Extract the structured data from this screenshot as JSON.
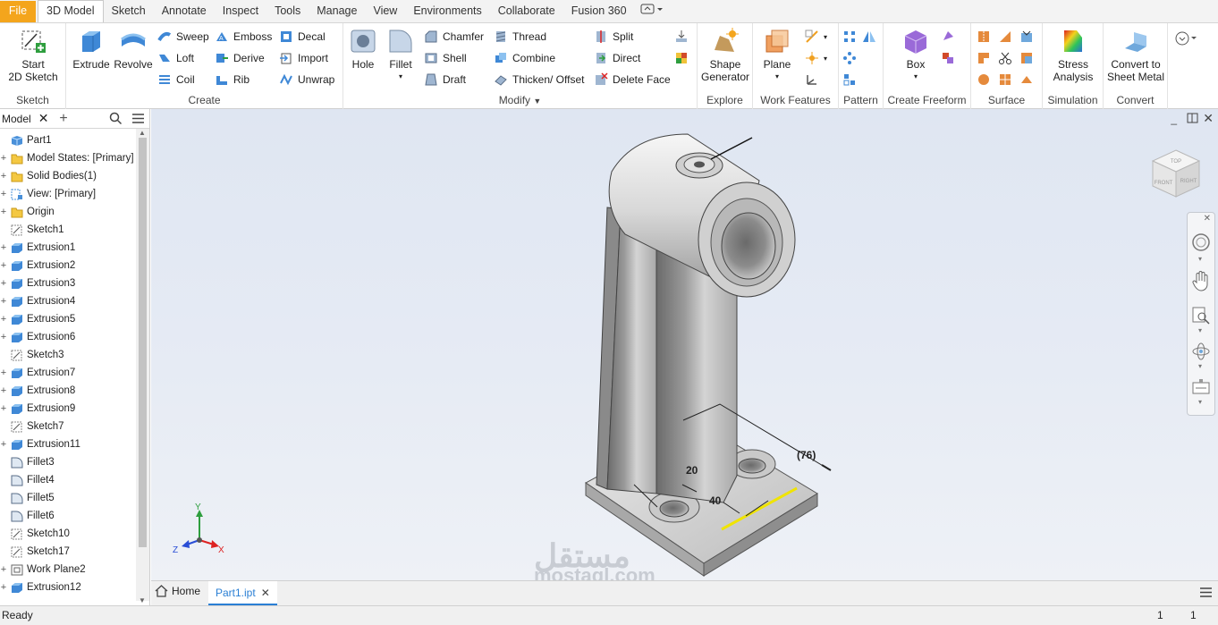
{
  "menu": [
    "File",
    "3D Model",
    "Sketch",
    "Annotate",
    "Inspect",
    "Tools",
    "Manage",
    "View",
    "Environments",
    "Collaborate",
    "Fusion 360"
  ],
  "ribbon": {
    "sketch": {
      "label": "Sketch",
      "start": "Start",
      "start2": "2D Sketch"
    },
    "create": {
      "label": "Create",
      "extrude": "Extrude",
      "revolve": "Revolve",
      "sweep": "Sweep",
      "emboss": "Emboss",
      "decal": "Decal",
      "loft": "Loft",
      "derive": "Derive",
      "import": "Import",
      "coil": "Coil",
      "rib": "Rib",
      "unwrap": "Unwrap"
    },
    "modify": {
      "label": "Modify",
      "hole": "Hole",
      "fillet": "Fillet",
      "chamfer": "Chamfer",
      "thread": "Thread",
      "split": "Split",
      "shell": "Shell",
      "combine": "Combine",
      "direct": "Direct",
      "draft": "Draft",
      "thicken": "Thicken/ Offset",
      "delete_face": "Delete Face"
    },
    "explore": {
      "label": "Explore",
      "shape1": "Shape",
      "shape2": "Generator"
    },
    "work": {
      "label": "Work Features",
      "plane": "Plane"
    },
    "pattern": {
      "label": "Pattern"
    },
    "freeform": {
      "label": "Create Freeform",
      "box": "Box"
    },
    "surface": {
      "label": "Surface"
    },
    "simulation": {
      "label": "Simulation",
      "stress1": "Stress",
      "stress2": "Analysis"
    },
    "convert": {
      "label": "Convert",
      "sm1": "Convert to",
      "sm2": "Sheet Metal"
    }
  },
  "browser": {
    "tab": "Model",
    "items": [
      {
        "label": "Part1",
        "icon": "part",
        "plus": ""
      },
      {
        "label": "Model States: [Primary]",
        "icon": "folder",
        "plus": "+"
      },
      {
        "label": "Solid Bodies(1)",
        "icon": "folder",
        "plus": "+"
      },
      {
        "label": "View: [Primary]",
        "icon": "view",
        "plus": "+"
      },
      {
        "label": "Origin",
        "icon": "folder",
        "plus": "+"
      },
      {
        "label": "Sketch1",
        "icon": "sketch",
        "plus": ""
      },
      {
        "label": "Extrusion1",
        "icon": "extrude",
        "plus": "+"
      },
      {
        "label": "Extrusion2",
        "icon": "extrude",
        "plus": "+"
      },
      {
        "label": "Extrusion3",
        "icon": "extrude",
        "plus": "+"
      },
      {
        "label": "Extrusion4",
        "icon": "extrude",
        "plus": "+"
      },
      {
        "label": "Extrusion5",
        "icon": "extrude",
        "plus": "+"
      },
      {
        "label": "Extrusion6",
        "icon": "extrude",
        "plus": "+"
      },
      {
        "label": "Sketch3",
        "icon": "sketch",
        "plus": ""
      },
      {
        "label": "Extrusion7",
        "icon": "extrude",
        "plus": "+"
      },
      {
        "label": "Extrusion8",
        "icon": "extrude",
        "plus": "+"
      },
      {
        "label": "Extrusion9",
        "icon": "extrude",
        "plus": "+"
      },
      {
        "label": "Sketch7",
        "icon": "sketch",
        "plus": ""
      },
      {
        "label": "Extrusion11",
        "icon": "extrude",
        "plus": "+"
      },
      {
        "label": "Fillet3",
        "icon": "fillet",
        "plus": ""
      },
      {
        "label": "Fillet4",
        "icon": "fillet",
        "plus": ""
      },
      {
        "label": "Fillet5",
        "icon": "fillet",
        "plus": ""
      },
      {
        "label": "Fillet6",
        "icon": "fillet",
        "plus": ""
      },
      {
        "label": "Sketch10",
        "icon": "sketch",
        "plus": ""
      },
      {
        "label": "Sketch17",
        "icon": "sketch",
        "plus": ""
      },
      {
        "label": "Work Plane2",
        "icon": "plane",
        "plus": "+"
      },
      {
        "label": "Extrusion12",
        "icon": "extrude",
        "plus": "+"
      }
    ]
  },
  "viewport": {
    "dims": [
      "(76)",
      "20",
      "40"
    ],
    "viewcube": [
      "TOP",
      "FRONT",
      "RIGHT"
    ],
    "axes": [
      "Y",
      "X",
      "Z"
    ],
    "watermark1": "مستقل",
    "watermark2": "mostaql.com"
  },
  "doctabs": {
    "home": "Home",
    "part": "Part1.ipt"
  },
  "status": {
    "text": "Ready",
    "n1": "1",
    "n2": "1"
  },
  "colors": {
    "file_tab": "#f4a51c",
    "accent": "#4a90d9",
    "highlight": "#f0e400"
  }
}
